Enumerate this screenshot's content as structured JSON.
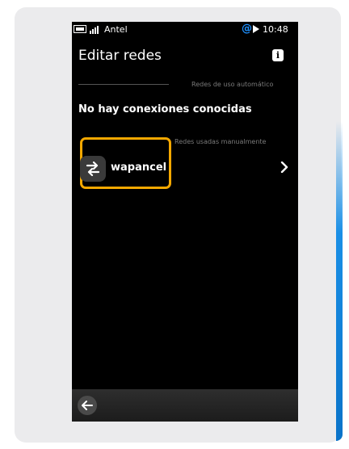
{
  "statusbar": {
    "carrier": "Antel",
    "time": "10:48",
    "icons": [
      "battery-icon",
      "signal-icon",
      "at-icon",
      "speaker-icon"
    ]
  },
  "header": {
    "title": "Editar redes",
    "info_label": "i"
  },
  "sections": {
    "automatic": {
      "label": "Redes de uso automático",
      "empty_text": "No hay conexiones conocidas"
    },
    "manual": {
      "label": "Redes usadas manualmente"
    }
  },
  "networks": [
    {
      "name": "wapancel",
      "icon": "swap-arrows-icon"
    }
  ],
  "toolbar": {
    "back_icon": "back-arrow-icon"
  },
  "colors": {
    "highlight": "#f5a800",
    "at_symbol": "#1e90ff",
    "accent_edge": "#1a8fe6"
  },
  "glyphs": {
    "at": "@"
  }
}
